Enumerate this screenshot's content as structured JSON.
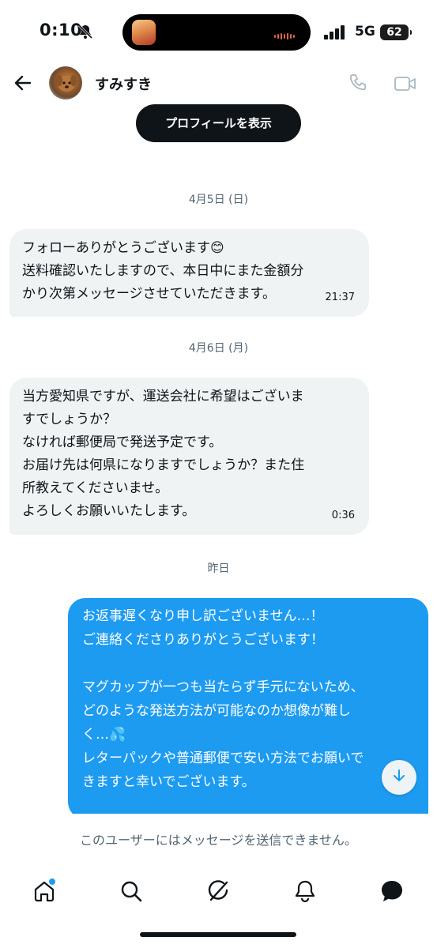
{
  "status_bar": {
    "time": "0:10",
    "network": "5G",
    "battery": "62"
  },
  "header": {
    "username": "すみすき"
  },
  "profile_button": "プロフィールを表示",
  "messages": [
    {
      "date": "4月5日 (日)",
      "text": "フォローありがとうございます😊\n送料確認いたしますので、本日中にまた金額分\nかり次第メッセージさせていただきます。",
      "time": "21:37"
    },
    {
      "date": "4月6日 (月)",
      "text": "当方愛知県ですが、運送会社に希望はございま\nすでしょうか？\nなければ郵便局で発送予定です。\nお届け先は何県になりますでしょうか？また住\n所教えてくださいませ。\nよろしくお願いいたします。",
      "time": "0:36"
    }
  ],
  "outgoing": {
    "date": "昨日",
    "text": "お返事遅くなり申し訳ございません…！\nご連絡くださりありがとうございます！\n\nマグカップが一つも当たらず手元にないため、\nどのような発送方法が可能なのか想像が難し\nく…💦\nレターパックや普通郵便で安い方法でお願いで\nきますと幸いでございます。"
  },
  "notice": "このユーザーにはメッセージを送信できません。",
  "colors": {
    "accent": "#1d9bf0",
    "incoming_bubble": "#eff3f4",
    "text": "#0f1419",
    "muted": "#536471"
  },
  "icons": [
    "bell-off-icon",
    "back-arrow-icon",
    "phone-icon",
    "video-icon",
    "arrow-down-icon",
    "home-icon",
    "search-icon",
    "grok-icon",
    "notifications-icon",
    "messages-icon"
  ]
}
